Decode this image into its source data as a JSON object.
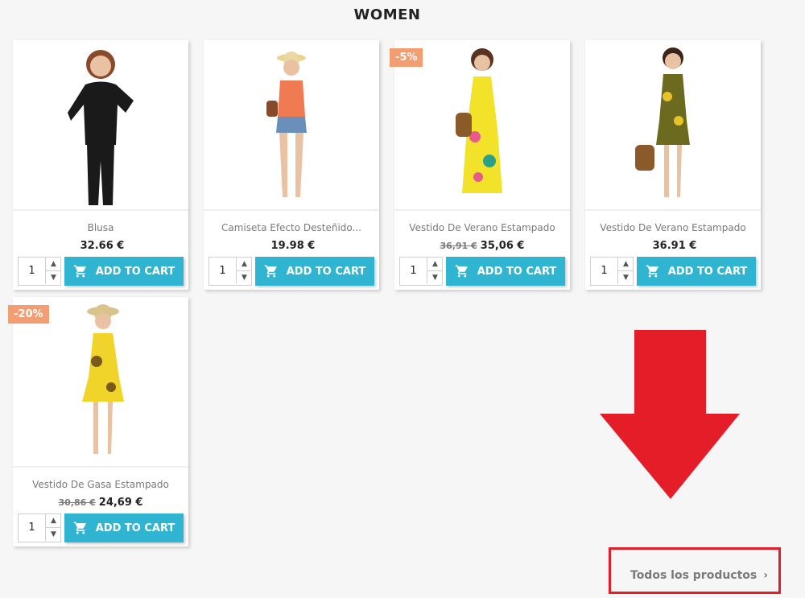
{
  "section": {
    "title": "WOMEN"
  },
  "products": [
    {
      "name": "Blusa",
      "old_price": "",
      "price": "32.66 €",
      "badge": "",
      "qty": "1",
      "cart_label": "ADD TO CART",
      "dress": "#111111"
    },
    {
      "name": "Camiseta Efecto Desteñido...",
      "old_price": "",
      "price": "19.98 €",
      "badge": "",
      "qty": "1",
      "cart_label": "ADD TO CART",
      "dress": "#f07a52"
    },
    {
      "name": "Vestido De Verano Estampado",
      "old_price": "36,91 €",
      "price": "35,06 €",
      "badge": "-5%",
      "qty": "1",
      "cart_label": "ADD TO CART",
      "dress": "#f2e22a"
    },
    {
      "name": "Vestido De Verano Estampado",
      "old_price": "",
      "price": "36.91 €",
      "badge": "",
      "qty": "1",
      "cart_label": "ADD TO CART",
      "dress": "#6b6a1f"
    },
    {
      "name": "Vestido De Gasa Estampado",
      "old_price": "30,86 €",
      "price": "24,69 €",
      "badge": "-20%",
      "qty": "1",
      "cart_label": "ADD TO CART",
      "dress": "#f0d42a"
    }
  ],
  "footer_link": {
    "label": "Todos los productos",
    "chevron": "›"
  },
  "colors": {
    "accent": "#2fb5d2",
    "badge": "#f39d72",
    "annotation": "#e41d29"
  }
}
